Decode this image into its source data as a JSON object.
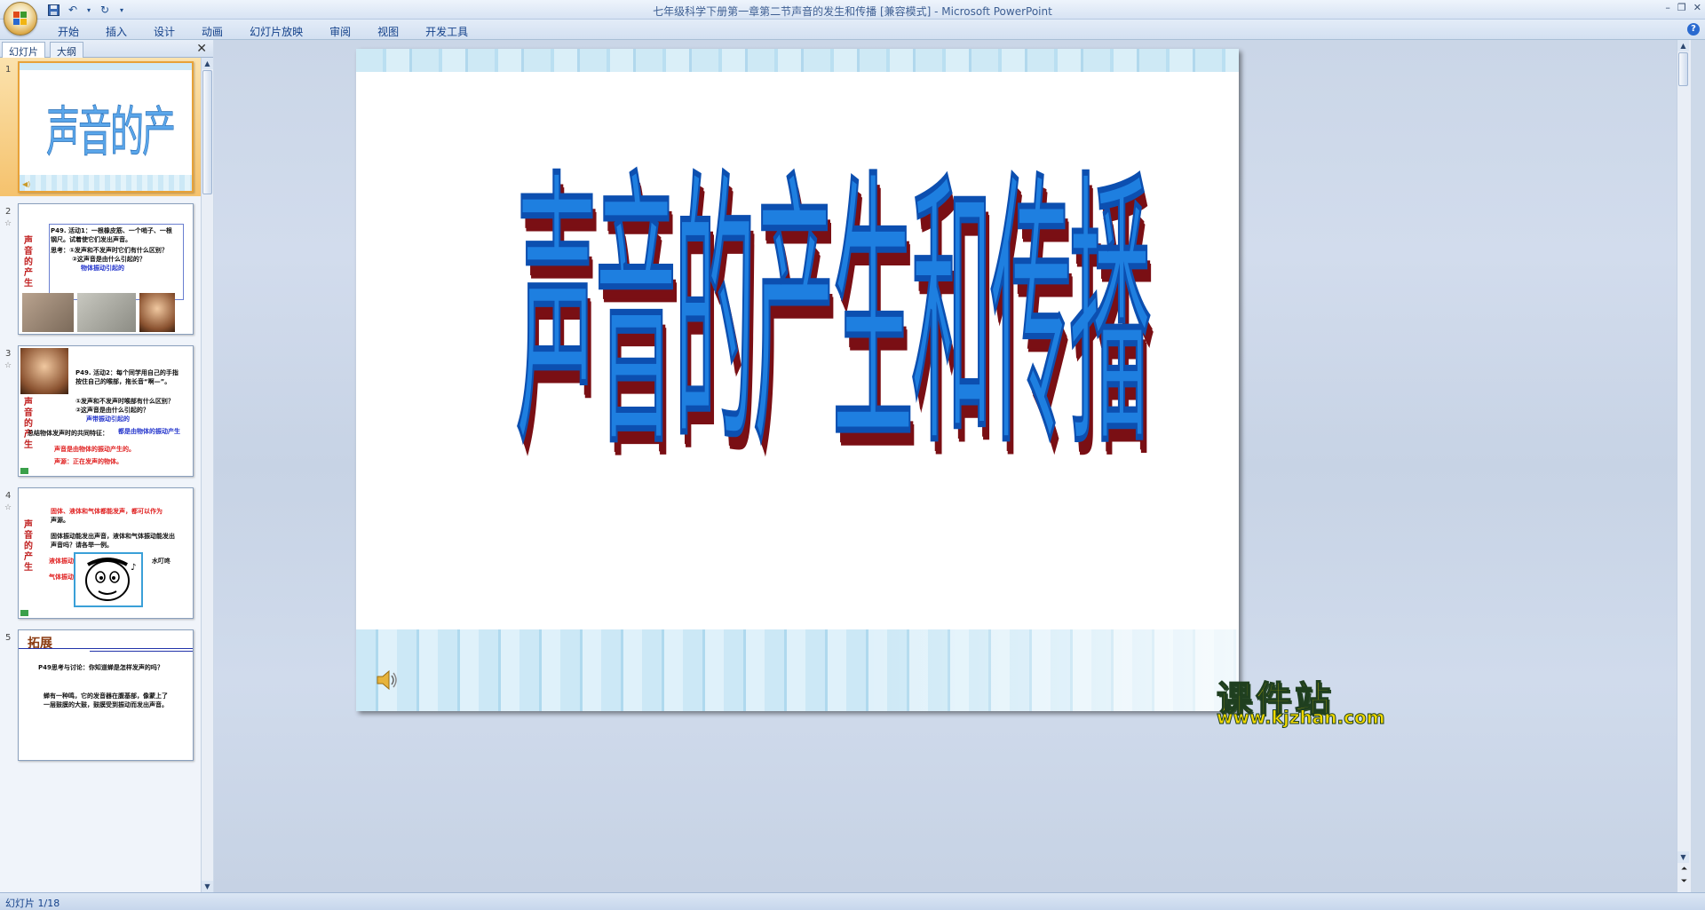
{
  "window": {
    "title": "七年级科学下册第一章第二节声音的发生和传播 [兼容模式] - Microsoft PowerPoint"
  },
  "ribbon": {
    "tabs": [
      {
        "label": "开始"
      },
      {
        "label": "插入"
      },
      {
        "label": "设计"
      },
      {
        "label": "动画"
      },
      {
        "label": "幻灯片放映"
      },
      {
        "label": "审阅"
      },
      {
        "label": "视图"
      },
      {
        "label": "开发工具"
      }
    ]
  },
  "panel": {
    "tabs": [
      {
        "label": "幻灯片"
      },
      {
        "label": "大纲"
      }
    ],
    "slides": [
      {
        "number": "1",
        "title": "声音的产生和传播"
      },
      {
        "number": "2",
        "side": "声音的产生",
        "lines": [
          "P49. 活动1：一根橡皮筋、一个哨子、一根",
          "钢尺。试着使它们发出声音。",
          "思考：①发声和不发声时它们有什么区别？",
          "②这声音是由什么引起的？",
          "物体振动引起的"
        ]
      },
      {
        "number": "3",
        "side": "声音的产生",
        "lines": [
          "P49. 活动2：每个同学用自己的手指",
          "按住自己的喉部，拖长音“啊—”。",
          "①发声和不发声时喉部有什么区别？",
          "②这声音是由什么引起的？",
          "声带振动引起的",
          "总结物体发声时的共同特征：",
          "都是由物体的振动产生",
          "声音是由物体的振动产生的。",
          "声源：正在发声的物体。"
        ]
      },
      {
        "number": "4",
        "side": "声音的产生",
        "lines": [
          "固体、液体和气体都能发声，都可以作为",
          "声源。",
          "固体振动能发出声音，液体和气体振动能发出",
          "声音吗？请各举一例。",
          "液体振动",
          "水叮咚",
          "气体振动"
        ]
      },
      {
        "number": "5",
        "title": "拓展",
        "lines": [
          "P49思考与讨论：你知道蝉是怎样发声的吗？",
          "蝉有一种鸣，它的发音器在腹基部，像蒙上了",
          "一层鼓膜的大鼓，鼓膜受到振动而发出声音。"
        ]
      }
    ]
  },
  "slide": {
    "title": "声音的产生和传播"
  },
  "watermark": {
    "text": "课件站",
    "url": "www.kjzhan.com"
  },
  "status": {
    "slide_position": "幻灯片 1/18"
  },
  "colors": {
    "title_fill": "#1e7fe0",
    "title_shadow": "#7a0f14",
    "selected_thumb": "#f5c26d",
    "watermark": "#f0d800"
  }
}
